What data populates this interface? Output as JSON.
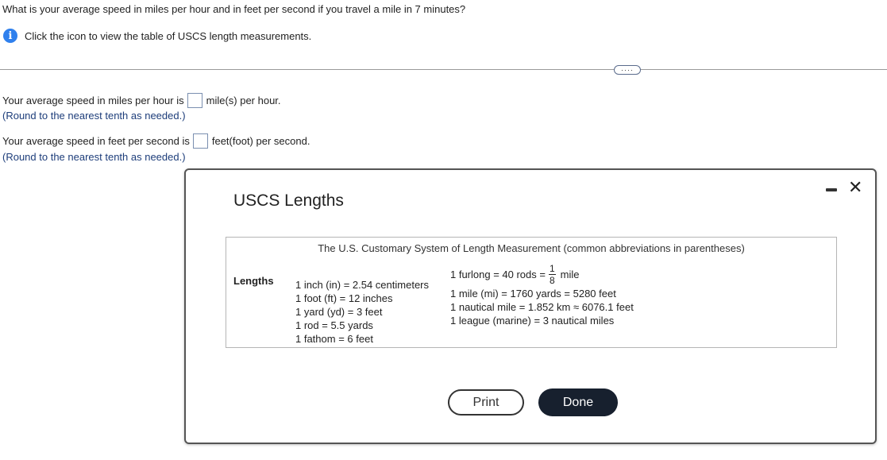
{
  "question": "What is your average speed in miles per hour and in feet per second if you travel a mile in 7 minutes?",
  "info": {
    "icon": "info-icon",
    "text": "Click the icon to view the table of USCS length measurements."
  },
  "expand_label": "····",
  "answers": [
    {
      "prefix": "Your average speed in miles per hour is",
      "value": "",
      "suffix": "mile(s) per hour.",
      "hint": "(Round to the nearest tenth as needed.)"
    },
    {
      "prefix": "Your average speed in feet per second is",
      "value": "",
      "suffix": "feet(foot) per second.",
      "hint": "(Round to the nearest tenth as needed.)"
    }
  ],
  "dialog": {
    "title": "USCS Lengths",
    "minimize_icon": "minimize-icon",
    "close_icon": "close-icon",
    "close_glyph": "✕",
    "table": {
      "caption": "The U.S. Customary System of Length Measurement (common abbreviations in parentheses)",
      "row_label": "Lengths",
      "col1": [
        "1 inch (in) = 2.54 centimeters",
        "1 foot (ft) = 12 inches",
        "1 yard (yd) = 3 feet",
        "1 rod = 5.5 yards",
        "1 fathom = 6 feet"
      ],
      "furlong": {
        "lead": "1 furlong = 40 rods =",
        "num": "1",
        "den": "8",
        "tail": "mile"
      },
      "col2": [
        "1 mile (mi) = 1760 yards = 5280 feet",
        "1 nautical mile = 1.852 km ≈ 6076.1 feet",
        "1 league (marine) = 3 nautical miles"
      ]
    },
    "print_label": "Print",
    "done_label": "Done"
  }
}
